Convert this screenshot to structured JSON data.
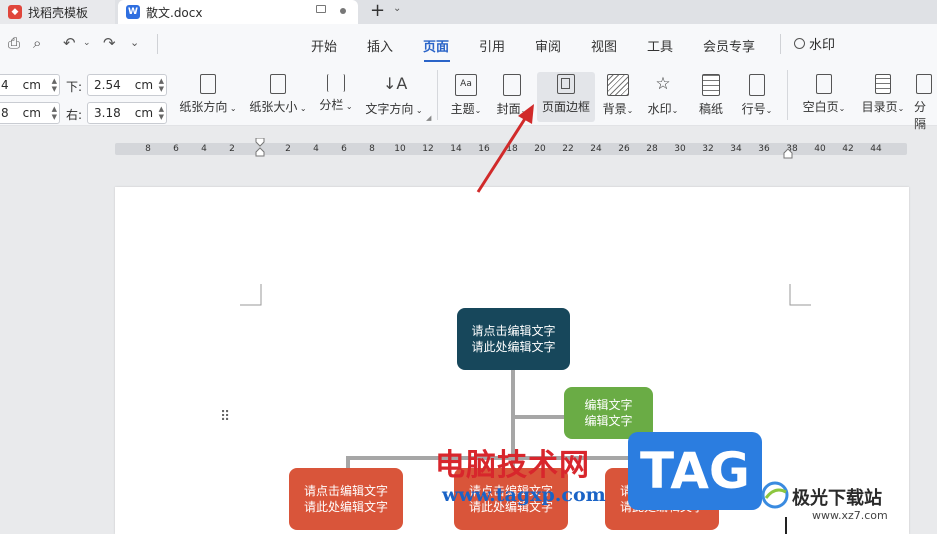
{
  "tabs": [
    {
      "label": "找稻壳模板",
      "icon": "docer-icon"
    },
    {
      "label": "散文.docx",
      "icon": "word-icon"
    }
  ],
  "new_tab_symbol": "+",
  "menu": {
    "items": [
      "开始",
      "插入",
      "页面",
      "引用",
      "审阅",
      "视图",
      "工具",
      "会员专享"
    ],
    "active": "页面",
    "search_label": "水印"
  },
  "margins": {
    "top_value_partial": "4",
    "left_value_partial": "8",
    "unit": "cm",
    "bottom_label": "下:",
    "bottom_value": "2.54",
    "right_label": "右:",
    "right_value": "3.18"
  },
  "ribbon": {
    "orientation": "纸张方向",
    "size": "纸张大小",
    "columns": "分栏",
    "text_direction": "文字方向",
    "theme": "主题",
    "cover": "封面",
    "page_border": "页面边框",
    "background": "背景",
    "watermark": "水印",
    "manuscript": "稿纸",
    "line_number": "行号",
    "blank_page": "空白页",
    "toc_page": "目录页",
    "section_partial": "分隔"
  },
  "ruler": {
    "left_numbers": [
      "8",
      "6",
      "4",
      "2"
    ],
    "right_numbers": [
      "2",
      "4",
      "6",
      "8",
      "10",
      "12",
      "14",
      "16",
      "18",
      "20",
      "22",
      "24",
      "26",
      "28",
      "30",
      "32",
      "34",
      "36",
      "38",
      "40",
      "42",
      "44"
    ]
  },
  "diagram": {
    "root": [
      "请点击编辑文字",
      "请此处编辑文字"
    ],
    "assistant": [
      "编辑文字",
      "编辑文字"
    ],
    "child1": [
      "请点击编辑文字",
      "请此处编辑文字"
    ],
    "child2": [
      "请点击编辑文字",
      "请此处编辑文字"
    ],
    "child3": [
      "请点击编辑文字",
      "请此处编辑文字"
    ],
    "colors": {
      "root": "#17475b",
      "assistant": "#6aac45",
      "child": "#d9553a"
    }
  },
  "watermark": {
    "site_name": "电脑技术网",
    "site_url": "www.tagxp.com",
    "badge": "TAG",
    "brand_name": "极光下载站",
    "brand_url": "www.xz7.com"
  }
}
